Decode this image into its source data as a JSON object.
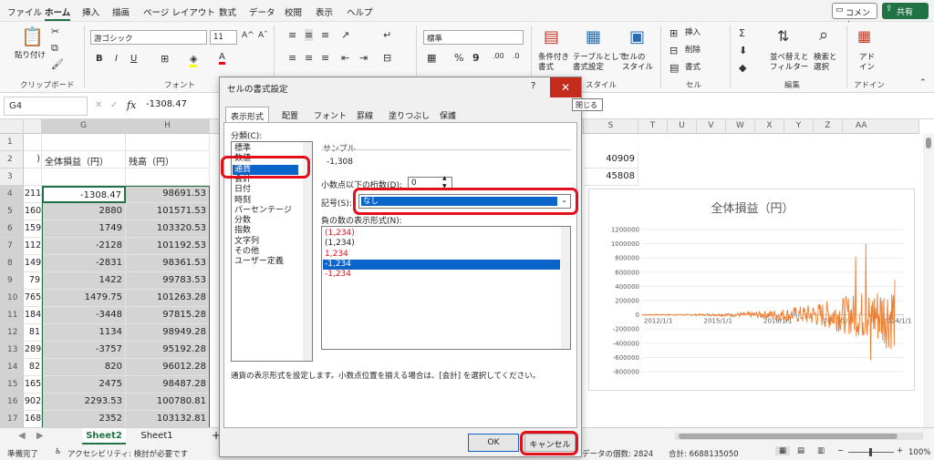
{
  "menubar": {
    "items": [
      "ファイル",
      "ホーム",
      "挿入",
      "描画",
      "ページ レイアウト",
      "数式",
      "データ",
      "校閲",
      "表示",
      "ヘルプ"
    ],
    "comment": "コメント",
    "share": "共有"
  },
  "ribbon": {
    "paste": "貼り付け",
    "clipboard_label": "クリップボード",
    "font_name": "游ゴシック",
    "font_size": "11",
    "font_label": "フォント",
    "number_format": "標準",
    "conditional_format": "条件付き\n書式",
    "table_format": "テーブルとして\n書式設定",
    "cell_style": "セルの\nスタイル",
    "style_label": "スタイル",
    "insert": "挿入",
    "delete": "削除",
    "format": "書式",
    "cells_label": "セル",
    "sort_filter": "並べ替えと\nフィルター",
    "find_select": "検索と\n選択",
    "edit_label": "編集",
    "addin": "アド\nイン",
    "addin_label": "アドイン"
  },
  "formula_bar": {
    "cell_ref": "G4",
    "fx": "fx",
    "value": "-1308.47"
  },
  "grid": {
    "col_headers_left": [
      "G",
      "H"
    ],
    "col_headers_right": [
      "S",
      "T",
      "U",
      "V",
      "W",
      "X",
      "Y",
      "Z",
      "AA"
    ],
    "row_numbers": [
      "1",
      "2",
      "3",
      "4",
      "5",
      "6",
      "7",
      "8",
      "9",
      "10",
      "11",
      "12",
      "13",
      "14",
      "15",
      "16",
      "17"
    ],
    "header_row": {
      "f": ")",
      "g": "全体損益（円）",
      "h": "残高（円）"
    },
    "rows": [
      {
        "f": "211",
        "g": "-1308.47",
        "h": "98691.53"
      },
      {
        "f": "160",
        "g": "2880",
        "h": "101571.53"
      },
      {
        "f": "159",
        "g": "1749",
        "h": "103320.53"
      },
      {
        "f": "112",
        "g": "-2128",
        "h": "101192.53"
      },
      {
        "f": "149",
        "g": "-2831",
        "h": "98361.53"
      },
      {
        "f": "79",
        "g": "1422",
        "h": "99783.53"
      },
      {
        "f": "765",
        "g": "1479.75",
        "h": "101263.28"
      },
      {
        "f": "184",
        "g": "-3448",
        "h": "97815.28"
      },
      {
        "f": "81",
        "g": "1134",
        "h": "98949.28"
      },
      {
        "f": "289",
        "g": "-3757",
        "h": "95192.28"
      },
      {
        "f": "82",
        "g": "820",
        "h": "96012.28"
      },
      {
        "f": "165",
        "g": "2475",
        "h": "98487.28"
      },
      {
        "f": "902",
        "g": "2293.53",
        "h": "100780.81"
      },
      {
        "f": "168",
        "g": "2352",
        "h": "103132.81"
      }
    ],
    "r_values": [
      "40909",
      "45808"
    ]
  },
  "chart_data": {
    "type": "line",
    "title": "全体損益（円）",
    "y_ticks": [
      "1200000",
      "1000000",
      "800000",
      "600000",
      "400000",
      "200000",
      "0",
      "-200000",
      "-400000",
      "-600000",
      "-800000"
    ],
    "ylim": [
      -800000,
      1200000
    ],
    "x_ticks": [
      "2012/1/1",
      "2015/1/1",
      "2018/1/1",
      "2021/1/1",
      "2024/1/1"
    ],
    "series_color": "#ed7d31"
  },
  "dialog": {
    "title": "セルの書式設定",
    "help": "?",
    "tabs": [
      "表示形式",
      "配置",
      "フォント",
      "罫線",
      "塗りつぶし",
      "保護"
    ],
    "category_label": "分類(C):",
    "categories": [
      "標準",
      "数値",
      "通貨",
      "会計",
      "日付",
      "時刻",
      "パーセンテージ",
      "分数",
      "指数",
      "文字列",
      "その他",
      "ユーザー定義"
    ],
    "selected_category": "通貨",
    "sample_label": "サンプル",
    "sample_value": "-1,308",
    "decimal_label": "小数点以下の桁数(D):",
    "decimal_value": "0",
    "symbol_label": "記号(S):",
    "symbol_value": "なし",
    "negative_label": "負の数の表示形式(N):",
    "negative_formats": [
      {
        "text": "(1,234)",
        "color": "#e3101b"
      },
      {
        "text": "(1,234)",
        "color": "#222222"
      },
      {
        "text": "1,234",
        "color": "#e3101b"
      },
      {
        "text": "-1,234",
        "color": "#ffffff"
      },
      {
        "text": "-1,234",
        "color": "#e3101b"
      }
    ],
    "description": "通貨の表示形式を設定します。小数点位置を揃える場合は、[会計] を選択してください。",
    "ok": "OK",
    "cancel": "キャンセル",
    "close_tooltip": "閉じる"
  },
  "sheets": {
    "tabs": [
      "Sheet2",
      "Sheet1"
    ],
    "active": "Sheet2",
    "add": "+"
  },
  "status": {
    "ready": "準備完了",
    "accessibility": "アクセシビリティ: 検討が必要です",
    "count": "データの個数: 2824",
    "sum": "合計: 6688135050",
    "zoom": "100%"
  },
  "colors": {
    "accent": "#217346",
    "highlight": "#e3101b",
    "select_blue": "#0a64c9"
  }
}
